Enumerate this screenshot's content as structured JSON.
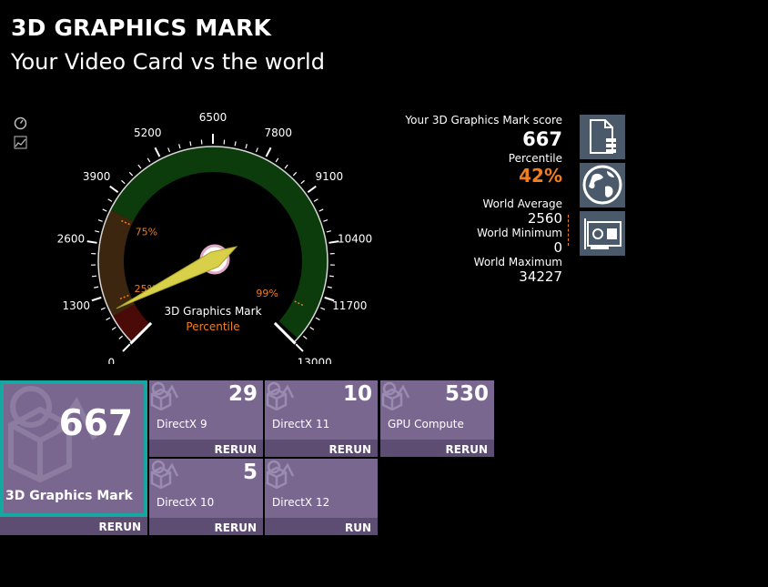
{
  "header": {
    "title": "3D GRAPHICS MARK",
    "subtitle": "Your Video Card vs the world"
  },
  "gauge": {
    "ticks": [
      "0",
      "1300",
      "2600",
      "3900",
      "5200",
      "6500",
      "7800",
      "9100",
      "10400",
      "11700",
      "13000"
    ],
    "percentile_marks": [
      "25%",
      "75%",
      "99%"
    ],
    "center_label": "3D Graphics Mark",
    "center_sub": "Percentile",
    "needle_value": 667,
    "max": 13000,
    "colors": {
      "red": "#4a0a08",
      "brown": "#3d2610",
      "green": "#0c3c0c",
      "needle": "#d8d048",
      "accent": "#f07d1e"
    }
  },
  "stats": {
    "score_label": "Your 3D Graphics Mark score",
    "score": "667",
    "percentile_label": "Percentile",
    "percentile": "42%",
    "world_average_label": "World Average",
    "world_average": "2560",
    "world_min_label": "World Minimum",
    "world_min": "0",
    "world_max_label": "World Maximum",
    "world_max": "34227"
  },
  "main_tile": {
    "score": "667",
    "label": "3D Graphics Mark",
    "action": "RERUN"
  },
  "tiles": [
    {
      "score": "29",
      "label": "DirectX 9",
      "action": "RERUN"
    },
    {
      "score": "10",
      "label": "DirectX 11",
      "action": "RERUN"
    },
    {
      "score": "530",
      "label": "GPU Compute",
      "action": "RERUN"
    },
    {
      "score": "5",
      "label": "DirectX 10",
      "action": "RERUN"
    },
    {
      "score": "",
      "label": "DirectX 12",
      "action": "RUN"
    }
  ]
}
